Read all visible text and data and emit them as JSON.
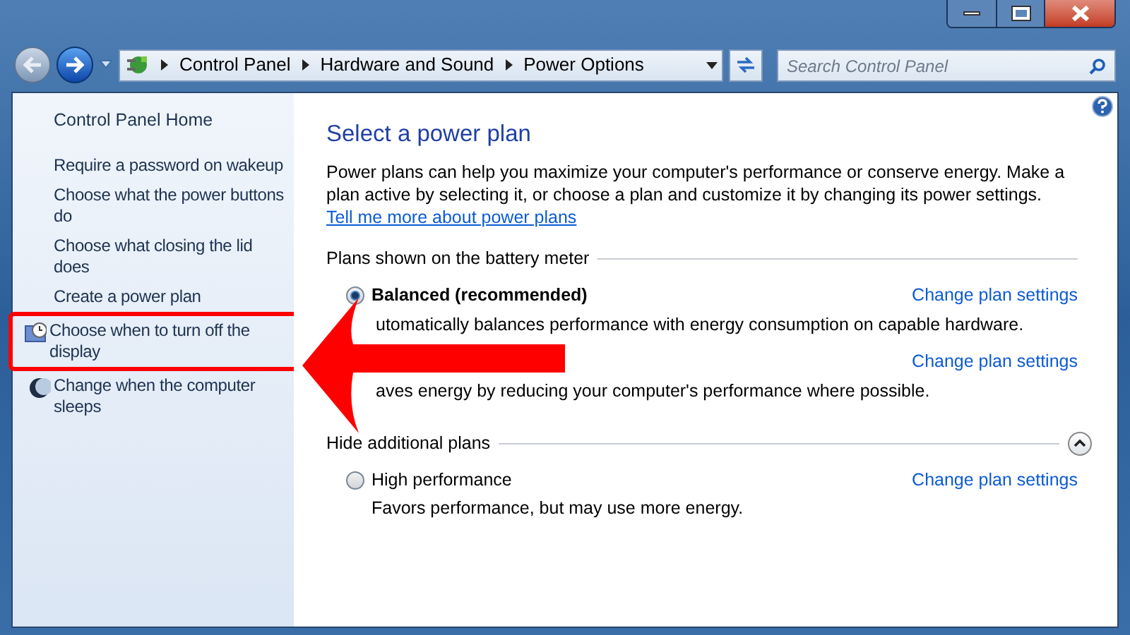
{
  "address_bar": {
    "breadcrumbs": [
      "Control Panel",
      "Hardware and Sound",
      "Power Options"
    ]
  },
  "search": {
    "placeholder": "Search Control Panel"
  },
  "sidebar": {
    "home": "Control Panel Home",
    "items": [
      {
        "label": "Require a password on wakeup",
        "kind": "plain"
      },
      {
        "label": "Choose what the power buttons do",
        "kind": "plain"
      },
      {
        "label": "Choose what closing the lid does",
        "kind": "plain"
      },
      {
        "label": "Create a power plan",
        "kind": "plain"
      },
      {
        "label": "Choose when to turn off the display",
        "kind": "display",
        "highlighted": true
      },
      {
        "label": "Change when the computer sleeps",
        "kind": "sleep"
      }
    ]
  },
  "main": {
    "title": "Select a power plan",
    "intro": "Power plans can help you maximize your computer's performance or conserve energy. Make a plan active by selecting it, or choose a plan and customize it by changing its power settings.",
    "intro_link": "Tell me more about power plans",
    "groups": [
      {
        "heading": "Plans shown on the battery meter",
        "plans": [
          {
            "name": "Balanced (recommended)",
            "selected": true,
            "description": "utomatically balances performance with energy consumption on capable hardware.",
            "link": "Change plan settings"
          },
          {
            "description": "aves energy by reducing your computer's performance where possible.",
            "link": "Change plan settings"
          }
        ]
      },
      {
        "heading": "Hide additional plans",
        "expanded": true,
        "plans": [
          {
            "name": "High performance",
            "selected": false,
            "description": "Favors performance, but may use more energy.",
            "link": "Change plan settings"
          }
        ]
      }
    ]
  }
}
